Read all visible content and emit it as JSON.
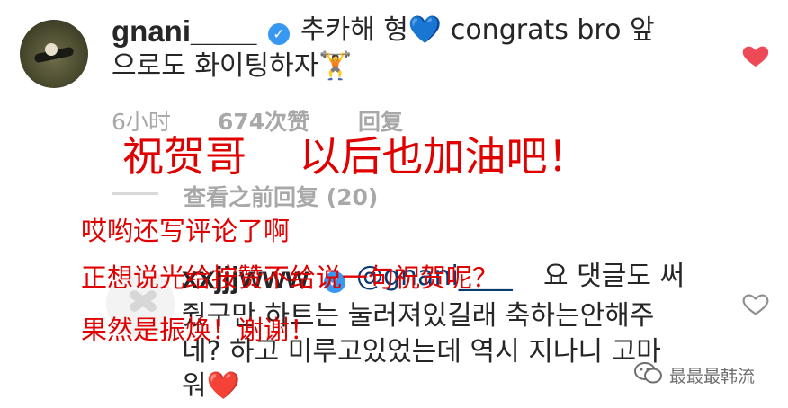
{
  "comment1": {
    "username": "gnani____",
    "text_line1": "추카해 형💙 congrats bro 앞",
    "text_line2": "으로도 화이팅하자🏋",
    "time": "6小时",
    "likes": "674次赞",
    "reply": "回复"
  },
  "view_replies": "查看之前回复 (20)",
  "comment2": {
    "username": "xxjjjwww",
    "mention": "@gnani____",
    "text_line1_tail": "요 댓글도 써",
    "text_line2": "줬구만 하트는 눌러져있길래 축하는안해주",
    "text_line3": "네? 하고 미루고있었는데 역시 지나니 고마",
    "text_line4": "워❤️"
  },
  "overlay": {
    "big_caption": "祝贺哥    以后也加油吧！",
    "line1": "哎哟还写评论了啊",
    "line2": "正想说光给按赞不给说一句祝贺呢？",
    "line3": "果然是振焕！谢谢！"
  },
  "watermark": {
    "text": "最最最韩流",
    "icon": "wechat-icon"
  },
  "colors": {
    "red_text": "#e00000",
    "verified_blue": "#3897f0",
    "heart_red": "#ed4956",
    "meta_gray": "#a8a8a8"
  }
}
